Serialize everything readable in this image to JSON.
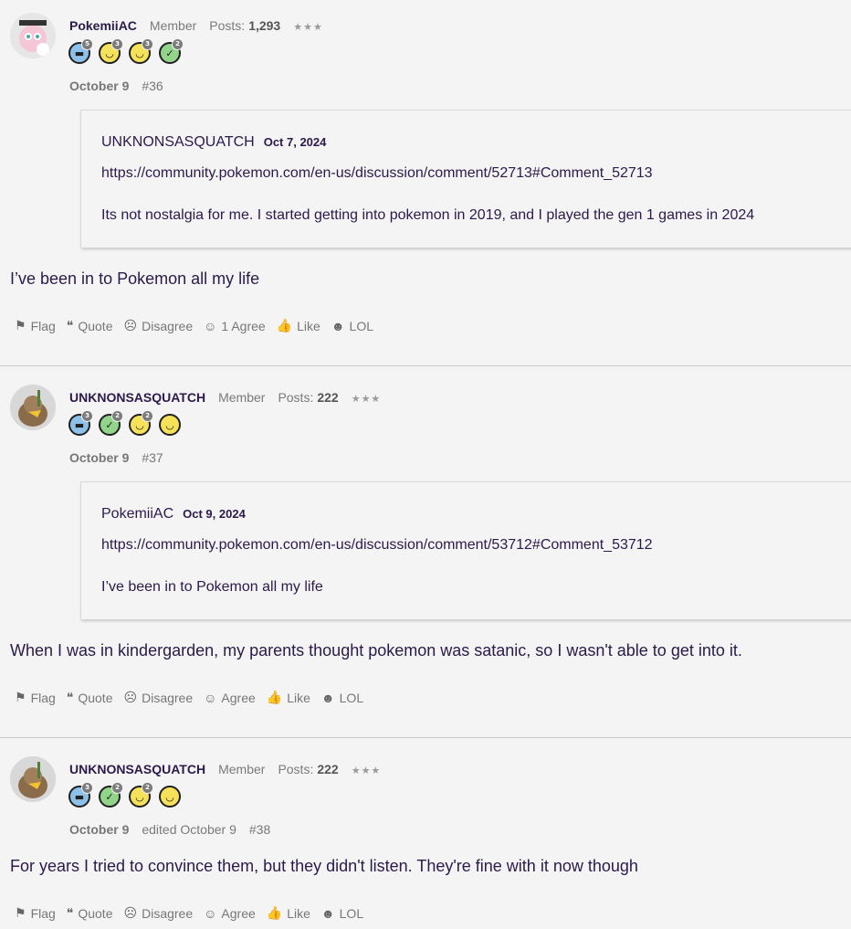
{
  "posts": [
    {
      "username": "PokemiiAC",
      "role": "Member",
      "posts_label": "Posts:",
      "posts_count": "1,293",
      "stars": "★★★",
      "badges": [
        {
          "icon": "speech-bubble-icon",
          "color": "#8dc1ea",
          "level": "5"
        },
        {
          "icon": "wink-face-icon",
          "color": "#f6e25a",
          "level": "3"
        },
        {
          "icon": "smile-face-icon",
          "color": "#f6e25a",
          "level": "3"
        },
        {
          "icon": "checkmark-icon",
          "color": "#92d48a",
          "level": "2"
        }
      ],
      "date": "October 9",
      "edited": "",
      "number": "#36",
      "quote": {
        "author": "UNKNONSASQUATCH",
        "date": "Oct 7, 2024",
        "link": "https://community.pokemon.com/en-us/discussion/comment/52713#Comment_52713",
        "text": "Its not nostalgia for me. I started getting into pokemon in 2019, and I played the gen 1 games in 2024"
      },
      "body": "I’ve been in to Pokemon all my life",
      "actions": {
        "flag": "Flag",
        "quote": "Quote",
        "disagree": "Disagree",
        "agree": "1 Agree",
        "like": "Like",
        "lol": "LOL"
      }
    },
    {
      "username": "UNKNONSASQUATCH",
      "role": "Member",
      "posts_label": "Posts:",
      "posts_count": "222",
      "stars": "★★★",
      "badges": [
        {
          "icon": "speech-bubble-icon",
          "color": "#8dc1ea",
          "level": "3"
        },
        {
          "icon": "checkmark-icon",
          "color": "#92d48a",
          "level": "2"
        },
        {
          "icon": "smile-face-icon",
          "color": "#f6e25a",
          "level": "2"
        },
        {
          "icon": "wink-face-icon",
          "color": "#f6e25a",
          "level": ""
        }
      ],
      "date": "October 9",
      "edited": "",
      "number": "#37",
      "quote": {
        "author": "PokemiiAC",
        "date": "Oct 9, 2024",
        "link": "https://community.pokemon.com/en-us/discussion/comment/53712#Comment_53712",
        "text": "I’ve been in to Pokemon all my life"
      },
      "body": "When I was in kindergarden, my parents thought pokemon was satanic, so I wasn't able to get into it.",
      "actions": {
        "flag": "Flag",
        "quote": "Quote",
        "disagree": "Disagree",
        "agree": "Agree",
        "like": "Like",
        "lol": "LOL"
      }
    },
    {
      "username": "UNKNONSASQUATCH",
      "role": "Member",
      "posts_label": "Posts:",
      "posts_count": "222",
      "stars": "★★★",
      "badges": [
        {
          "icon": "speech-bubble-icon",
          "color": "#8dc1ea",
          "level": "3"
        },
        {
          "icon": "checkmark-icon",
          "color": "#92d48a",
          "level": "2"
        },
        {
          "icon": "smile-face-icon",
          "color": "#f6e25a",
          "level": "2"
        },
        {
          "icon": "wink-face-icon",
          "color": "#f6e25a",
          "level": ""
        }
      ],
      "date": "October 9",
      "edited": "edited October 9",
      "number": "#38",
      "quote": null,
      "body": "For years I tried to convince them, but they didn't listen. They're fine with it now though",
      "actions": {
        "flag": "Flag",
        "quote": "Quote",
        "disagree": "Disagree",
        "agree": "Agree",
        "like": "Like",
        "lol": "LOL"
      }
    }
  ]
}
